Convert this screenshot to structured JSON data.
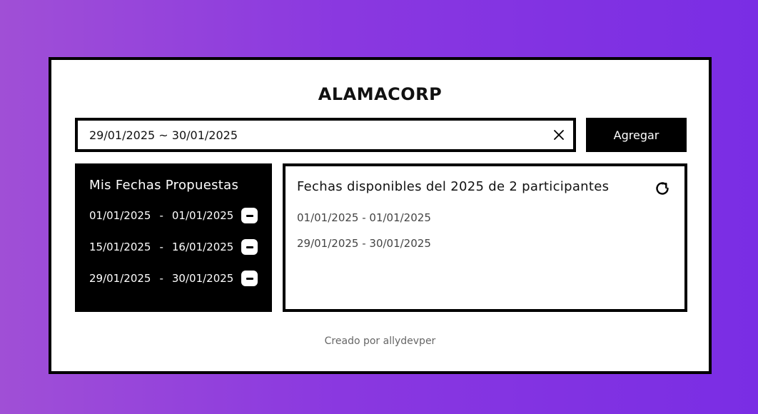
{
  "app": {
    "title": "ALAMACORP"
  },
  "date_input": {
    "value": "29/01/2025 ~ 30/01/2025"
  },
  "add_button": {
    "label": "Agregar"
  },
  "my_dates": {
    "title": "Mis Fechas Propuestas",
    "ranges": [
      {
        "start": "01/01/2025",
        "sep": "-",
        "end": "01/01/2025"
      },
      {
        "start": "15/01/2025",
        "sep": "-",
        "end": "16/01/2025"
      },
      {
        "start": "29/01/2025",
        "sep": "-",
        "end": "30/01/2025"
      }
    ]
  },
  "available": {
    "title": "Fechas disponibles del 2025 de 2 participantes",
    "items": [
      "01/01/2025 - 01/01/2025",
      "29/01/2025 - 30/01/2025"
    ]
  },
  "footer": {
    "text": "Creado por allydevper"
  },
  "icons": {
    "clear": "close-icon",
    "remove": "minus-icon",
    "refresh": "refresh-icon"
  }
}
